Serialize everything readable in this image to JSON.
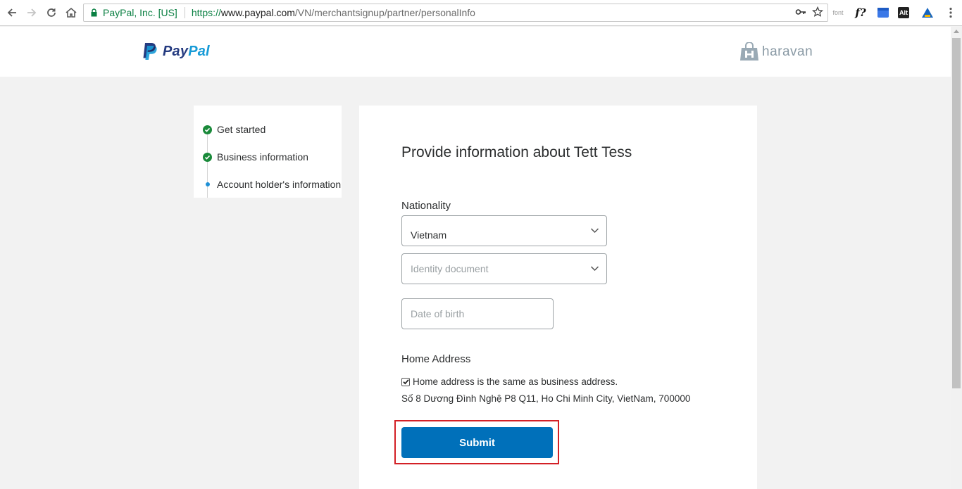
{
  "browser": {
    "secure_label": "PayPal, Inc. [US]",
    "url_scheme": "https://",
    "url_host": "www.paypal.com",
    "url_path": "/VN/merchantsignup/partner/personalInfo",
    "extensions": {
      "font_label": "font",
      "whatfont_label": "f?",
      "alt_label": "Alt"
    }
  },
  "header": {
    "paypal_pay": "Pay",
    "paypal_pal": "Pal",
    "partner_name": "haravan"
  },
  "steps": [
    {
      "label": "Get started",
      "status": "done"
    },
    {
      "label": "Business information",
      "status": "done"
    },
    {
      "label": "Account holder's information",
      "status": "current"
    }
  ],
  "form": {
    "title": "Provide information about Tett Tess",
    "nationality_label": "Nationality",
    "nationality_value": "Vietnam",
    "identity_placeholder": "Identity document",
    "dob_placeholder": "Date of birth",
    "home_address_label": "Home Address",
    "same_address_label": "Home address is the same as business address.",
    "same_address_checked": true,
    "business_address": "Số 8 Dương Đình Nghệ P8 Q11, Ho Chi Minh City, VietNam, 700000",
    "submit_label": "Submit"
  },
  "colors": {
    "brand_dark": "#253b80",
    "brand_light": "#179bd7",
    "button": "#0070ba",
    "highlight": "#d32026",
    "step_done": "#1a8a3a",
    "step_current": "#1e90d6"
  }
}
